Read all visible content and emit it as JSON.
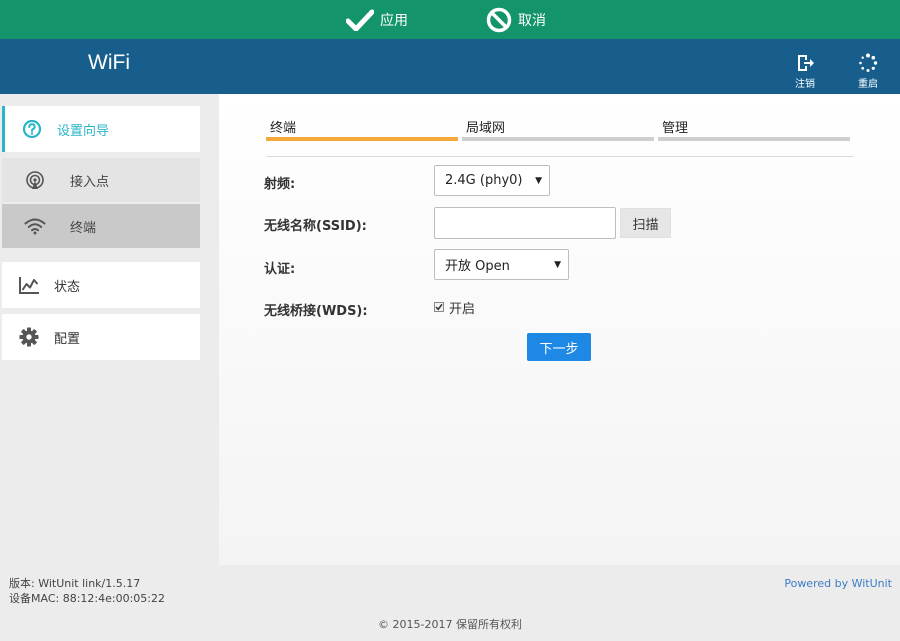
{
  "actionbar": {
    "apply_label": "应用",
    "cancel_label": "取消"
  },
  "header": {
    "brand": "WiFi",
    "logout_label": "注销",
    "reboot_label": "重启"
  },
  "sidebar": {
    "wizard": "设置向导",
    "access_point": "接入点",
    "terminal": "终端",
    "status": "状态",
    "config": "配置"
  },
  "tabs": [
    "终端",
    "局域网",
    "管理"
  ],
  "form": {
    "freq_label": "射频:",
    "freq_value": "2.4G (phy0)",
    "ssid_label": "无线名称(SSID):",
    "ssid_value": "",
    "scan_label": "扫描",
    "auth_label": "认证:",
    "auth_value": "开放 Open",
    "wds_label": "无线桥接(WDS):",
    "wds_checkbox_label": "开启",
    "wds_checked": true,
    "next_label": "下一步"
  },
  "footer": {
    "version": "版本: WitUnit link/1.5.17",
    "mac": "设备MAC: 88:12:4e:00:05:22",
    "powered": "Powered by WitUnit",
    "copyright": "© 2015-2017  保留所有权利"
  },
  "colors": {
    "actionbar": "#13946a",
    "header": "#175e8c",
    "accent": "#2ab5c8",
    "tab_active": "#f6a93b",
    "primary_button": "#1e88e5"
  }
}
